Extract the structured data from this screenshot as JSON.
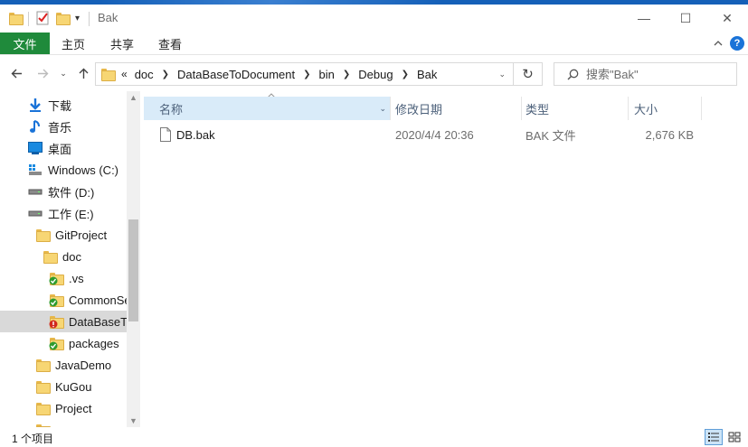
{
  "window": {
    "title": "Bak",
    "minimize": "—",
    "maximize": "☐",
    "close": "✕"
  },
  "ribbon": {
    "tabs": [
      "文件",
      "主页",
      "共享",
      "查看"
    ],
    "collapse_icon": "chevron-up-icon",
    "help": "?"
  },
  "address": {
    "prefix": "«",
    "breadcrumbs": [
      "doc",
      "DataBaseToDocument",
      "bin",
      "Debug",
      "Bak"
    ],
    "search_placeholder": "搜索\"Bak\""
  },
  "nav": {
    "items": [
      {
        "label": "下载",
        "icon": "download-arrow-icon",
        "indent": 1
      },
      {
        "label": "音乐",
        "icon": "music-note-icon",
        "indent": 1
      },
      {
        "label": "桌面",
        "icon": "desktop-icon",
        "indent": 1
      },
      {
        "label": "Windows (C:)",
        "icon": "windows-drive-icon",
        "indent": 1
      },
      {
        "label": "软件 (D:)",
        "icon": "drive-icon",
        "indent": 1
      },
      {
        "label": "工作 (E:)",
        "icon": "drive-icon",
        "indent": 1
      },
      {
        "label": "GitProject",
        "icon": "folder-icon",
        "indent": 2
      },
      {
        "label": "doc",
        "icon": "folder-icon",
        "indent": 3
      },
      {
        "label": ".vs",
        "icon": "folder-git-synced-icon",
        "indent": 4
      },
      {
        "label": "CommonSe",
        "icon": "folder-git-synced-icon",
        "indent": 4
      },
      {
        "label": "DataBaseT",
        "icon": "folder-git-conflict-icon",
        "indent": 4,
        "selected": true
      },
      {
        "label": "packages",
        "icon": "folder-git-synced-icon",
        "indent": 4
      },
      {
        "label": "JavaDemo",
        "icon": "folder-icon",
        "indent": 2
      },
      {
        "label": "KuGou",
        "icon": "folder-icon",
        "indent": 2
      },
      {
        "label": "Project",
        "icon": "folder-icon",
        "indent": 2
      },
      {
        "label": "",
        "icon": "folder-icon",
        "indent": 2
      }
    ]
  },
  "columns": {
    "name": "名称",
    "modified": "修改日期",
    "type": "类型",
    "size": "大小"
  },
  "files": [
    {
      "name": "DB.bak",
      "modified": "2020/4/4 20:36",
      "type": "BAK 文件",
      "size": "2,676 KB"
    }
  ],
  "status": {
    "count": "1 个项目"
  },
  "colors": {
    "file_tab": "#1f8a3b",
    "header_highlight": "#d9ebf9",
    "selection": "#d9d9d9"
  }
}
